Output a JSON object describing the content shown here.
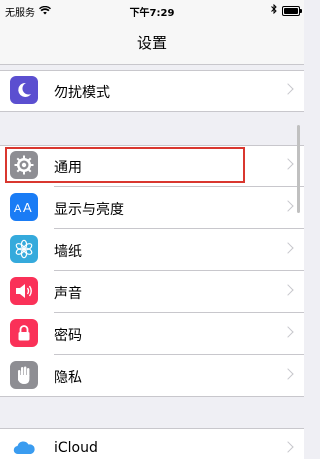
{
  "status_bar": {
    "carrier": "无服务",
    "time": "下午7:29"
  },
  "nav": {
    "title": "设置"
  },
  "groups": [
    {
      "items": [
        {
          "label": "勿扰模式",
          "icon": "moon-icon",
          "color": "#5b4fd0"
        }
      ]
    },
    {
      "items": [
        {
          "label": "通用",
          "icon": "gear-icon",
          "color": "#8e8e93",
          "highlighted": true
        },
        {
          "label": "显示与亮度",
          "icon": "text-size-icon",
          "color": "#1a7cf5"
        },
        {
          "label": "墙纸",
          "icon": "flower-icon",
          "color": "#35aadc"
        },
        {
          "label": "声音",
          "icon": "speaker-icon",
          "color": "#fa3158"
        },
        {
          "label": "密码",
          "icon": "lock-icon",
          "color": "#fa3158"
        },
        {
          "label": "隐私",
          "icon": "hand-icon",
          "color": "#8e8e93"
        }
      ]
    },
    {
      "items": [
        {
          "label": "iCloud",
          "icon": "cloud-icon",
          "color": "#3a9cf0"
        }
      ]
    }
  ]
}
